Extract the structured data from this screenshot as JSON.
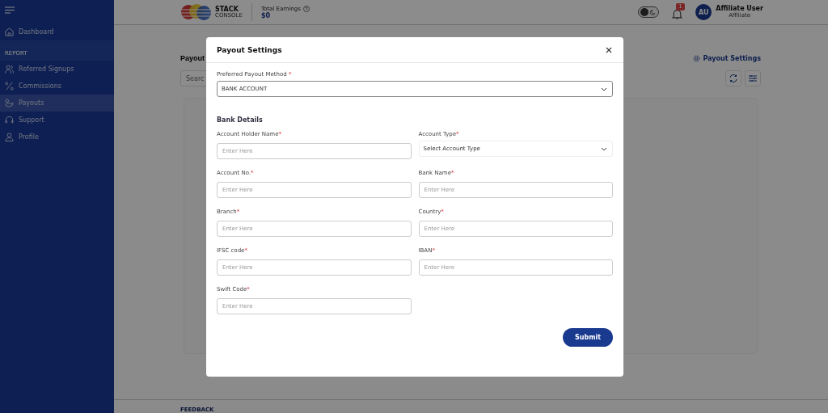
{
  "sidebar": {
    "items": [
      {
        "kind": "link",
        "label": "Dashboard",
        "selected": false
      },
      {
        "kind": "section",
        "label": "REPORT"
      },
      {
        "kind": "link",
        "label": "Referred Signups",
        "selected": false
      },
      {
        "kind": "link",
        "label": "Commissions",
        "selected": false
      },
      {
        "kind": "link",
        "label": "Payouts",
        "selected": true
      },
      {
        "kind": "link",
        "label": "Support",
        "selected": false
      },
      {
        "kind": "link",
        "label": "Profile",
        "selected": false
      }
    ]
  },
  "theme": {
    "dark": false
  },
  "header": {
    "logo": {
      "line1": "STACK",
      "line2": "CONSOLE"
    },
    "earnings": {
      "label": "Total Earnings",
      "value": "$0"
    },
    "notifications": "1",
    "user": {
      "initials": "AU",
      "name": "Affiliate User",
      "role": "Affiliate"
    }
  },
  "page": {
    "title": "Payout",
    "search": {
      "placeholder": "Searc"
    },
    "settings_link": "Payout Settings"
  },
  "footer": {
    "feedback": "FEEDBACK"
  },
  "modal": {
    "title": "Payout Settings",
    "method": {
      "label": "Preferred Payout Method",
      "mark": "*",
      "value": "BANK ACCOUNT"
    },
    "section": "Bank Details",
    "fields": [
      {
        "label": "Account Holder Name",
        "mark": "*",
        "kind": "input",
        "placeholder": "Enter Here"
      },
      {
        "label": "Account Type",
        "mark": "*",
        "kind": "select",
        "placeholder": "Select Account Type"
      },
      {
        "label": "Account No.",
        "mark": "*",
        "kind": "input",
        "placeholder": "Enter Here"
      },
      {
        "label": "Bank Name",
        "mark": "*",
        "kind": "input",
        "placeholder": "Enter Here"
      },
      {
        "label": "Branch",
        "mark": "*",
        "kind": "input",
        "placeholder": "Enter Here"
      },
      {
        "label": "Country",
        "mark": "*",
        "kind": "input",
        "placeholder": "Enter Here"
      },
      {
        "label": "IFSC code",
        "mark": "*",
        "kind": "input",
        "placeholder": "Enter Here"
      },
      {
        "label": "IBAN",
        "mark": "*",
        "kind": "input",
        "placeholder": "Enter Here"
      },
      {
        "label": "Swift Code",
        "mark": "*",
        "kind": "input",
        "placeholder": "Enter Here"
      }
    ],
    "submit": "Submit"
  }
}
